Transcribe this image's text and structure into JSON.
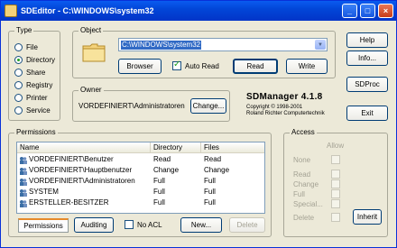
{
  "window": {
    "title": "SDEditor - C:\\WINDOWS\\system32",
    "minimize_glyph": "_",
    "maximize_glyph": "□",
    "close_glyph": "×"
  },
  "type_group": {
    "title": "Type",
    "options": [
      {
        "label": "File",
        "checked": false
      },
      {
        "label": "Directory",
        "checked": true
      },
      {
        "label": "Share",
        "checked": false
      },
      {
        "label": "Registry",
        "checked": false
      },
      {
        "label": "Printer",
        "checked": false
      },
      {
        "label": "Service",
        "checked": false
      }
    ]
  },
  "object_group": {
    "title": "Object",
    "path_value": "C:\\WINDOWS\\system32",
    "browse_label": "Browser",
    "auto_read_label": "Auto Read",
    "auto_read_checked": true,
    "read_label": "Read",
    "write_label": "Write"
  },
  "owner_group": {
    "title": "Owner",
    "owner_value": "VORDEFINIERT\\Administratoren",
    "change_label": "Change..."
  },
  "branding": {
    "product": "SDManager 4.1.8",
    "copyright": "Copyright © 1998-2001",
    "author": "Roland Richter Computertechnik"
  },
  "right_buttons": {
    "help": "Help",
    "info": "Info...",
    "sdproc": "SDProc",
    "exit": "Exit"
  },
  "permissions_group": {
    "title": "Permissions",
    "columns": [
      "Name",
      "Directory",
      "Files"
    ],
    "rows": [
      {
        "name": "VORDEFINIERT\\Benutzer",
        "directory": "Read",
        "files": "Read"
      },
      {
        "name": "VORDEFINIERT\\Hauptbenutzer",
        "directory": "Change",
        "files": "Change"
      },
      {
        "name": "VORDEFINIERT\\Administratoren",
        "directory": "Full",
        "files": "Full"
      },
      {
        "name": "SYSTEM",
        "directory": "Full",
        "files": "Full"
      },
      {
        "name": "ERSTELLER-BESITZER",
        "directory": "Full",
        "files": "Full"
      }
    ],
    "permissions_tab": "Permissions",
    "auditing_tab": "Auditing",
    "no_acl_label": "No ACL",
    "new_label": "New...",
    "delete_label": "Delete"
  },
  "access_group": {
    "title": "Access",
    "allow_header": "Allow",
    "items": [
      "None",
      "Read",
      "Change",
      "Full",
      "Special...",
      "Delete"
    ],
    "inherit_label": "Inherit"
  },
  "colors": {
    "titlebar": "#0246d8",
    "window_bg": "#ece9d8",
    "selection": "#316ac5"
  }
}
